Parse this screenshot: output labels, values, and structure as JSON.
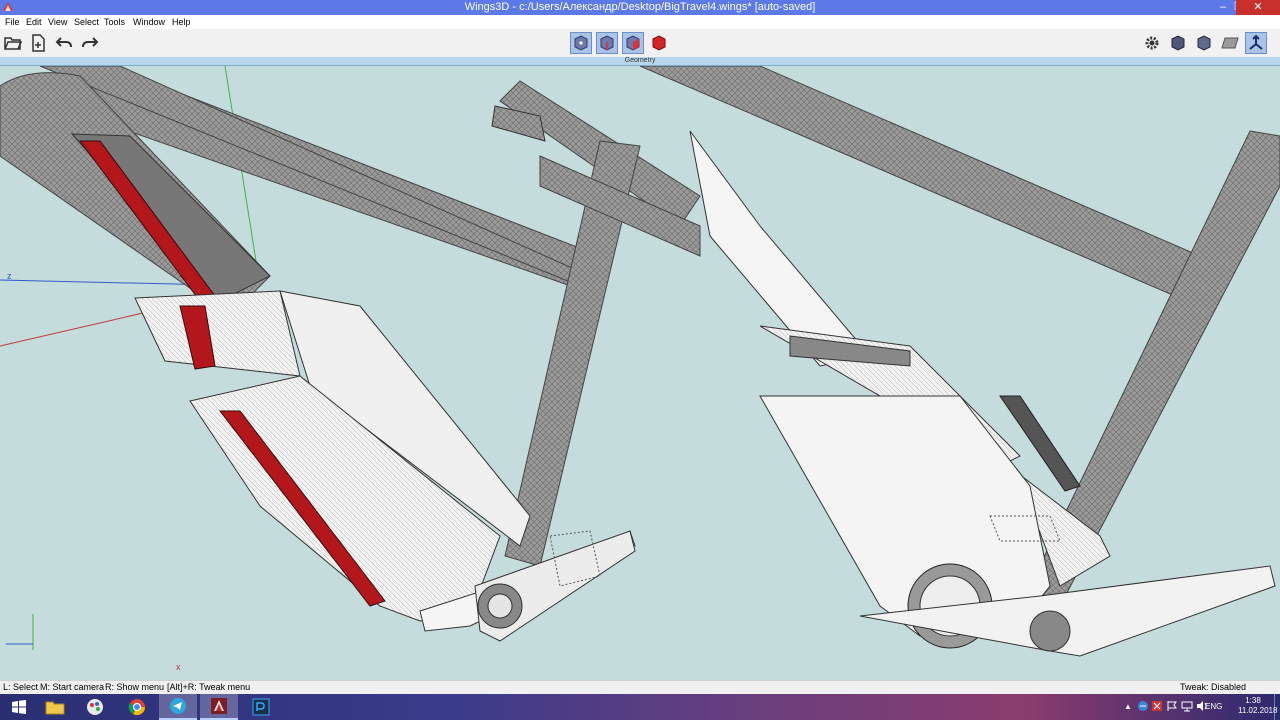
{
  "window": {
    "title": "Wings3D - c:/Users/Александр/Desktop/BigTravel4.wings* [auto-saved]",
    "controls": {
      "minimize": "–",
      "restore": "❐",
      "close": "✕"
    }
  },
  "menubar": {
    "items": [
      "File",
      "Edit",
      "View",
      "Select",
      "Tools",
      "Window",
      "Help"
    ]
  },
  "toolbar": {
    "left": [
      "open-icon",
      "import-icon",
      "undo-icon",
      "redo-icon"
    ],
    "center": [
      "vertex-mode-icon",
      "edge-mode-icon",
      "face-mode-icon",
      "object-mode-icon"
    ],
    "right": [
      "settings-icon",
      "workmode-cube-icon",
      "smooth-cube-icon",
      "ground-plane-icon",
      "perspective-icon"
    ]
  },
  "geometry_label": "Geometry",
  "viewport": {
    "background": "#c4dcdc",
    "axis_labels": {
      "z": "z",
      "x": "x"
    }
  },
  "statusbar": {
    "hints": [
      "L: Select",
      "M: Start camera",
      "R: Show menu",
      "[Alt]+R: Tweak menu"
    ],
    "tweak_status": "Tweak: Disabled"
  },
  "taskbar": {
    "apps": [
      "start-icon",
      "file-explorer-icon",
      "paint-app-icon",
      "chrome-icon",
      "telegram-icon",
      "wings3d-icon",
      "photoshop-icon"
    ],
    "tray": {
      "language": "ENG",
      "time": "1:38",
      "date": "11.02.2018"
    }
  }
}
